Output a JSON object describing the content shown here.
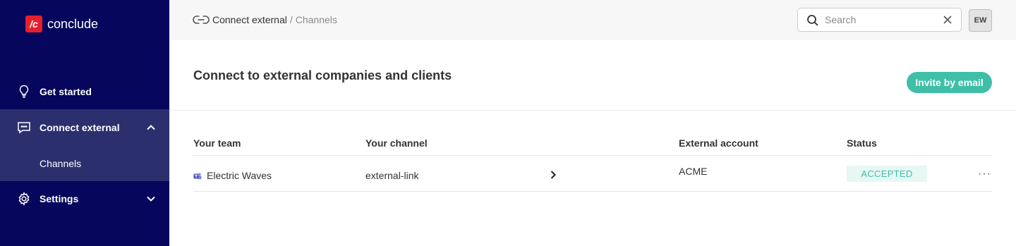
{
  "brand": {
    "logo_mark": "/c",
    "name": "conclude",
    "accent": "#e5202a"
  },
  "sidebar": {
    "items": [
      {
        "label": "Get started",
        "icon": "lightbulb-icon"
      },
      {
        "label": "Connect external",
        "icon": "chat-icon",
        "expanded": true
      },
      {
        "label": "Channels",
        "sub": true,
        "active": true
      },
      {
        "label": "Settings",
        "icon": "gear-icon",
        "expanded": false
      }
    ]
  },
  "topbar": {
    "breadcrumb_main": "Connect external",
    "breadcrumb_sep": "/",
    "breadcrumb_sub": "Channels",
    "search_placeholder": "Search",
    "avatar_initials": "EW"
  },
  "main": {
    "title": "Connect to external companies and clients",
    "invite_label": "Invite by email",
    "columns": [
      "Your team",
      "Your channel",
      "External account",
      "Status"
    ],
    "rows": [
      {
        "team": "Electric Waves",
        "channel": "external-link",
        "external_account": "ACME",
        "status": "ACCEPTED",
        "more": "···"
      }
    ]
  },
  "colors": {
    "sidebar_bg": "#05065c",
    "sidebar_active": "#2c2f6e",
    "accent_teal": "#3fbfa8"
  }
}
